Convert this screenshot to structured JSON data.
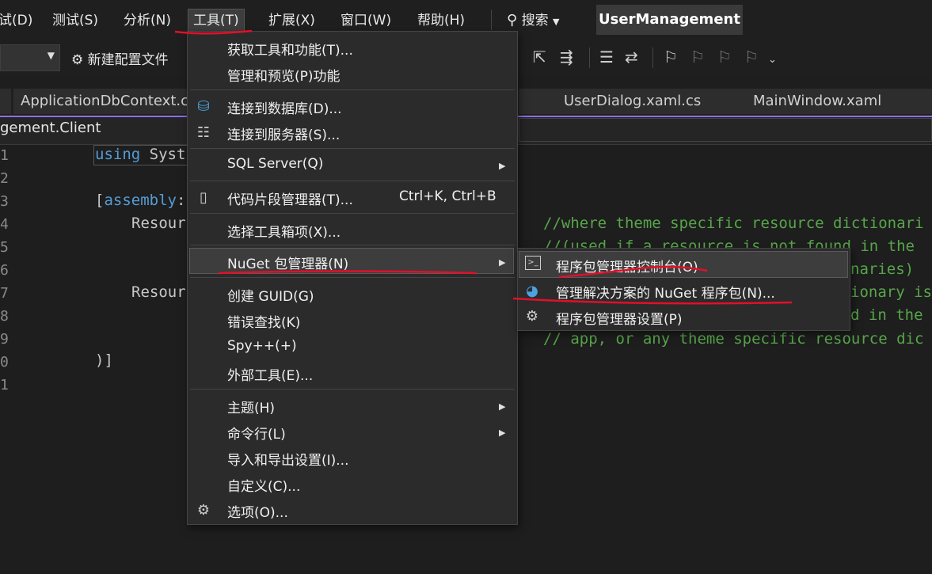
{
  "menubar": {
    "items": [
      "试(D)",
      "测试(S)",
      "分析(N)",
      "工具(T)",
      "扩展(X)",
      "窗口(W)",
      "帮助(H)"
    ],
    "search_label": "搜索",
    "solution_name": "UserManagement"
  },
  "toolbar": {
    "new_config_label": "新建配置文件"
  },
  "tabs": [
    "ApplicationDbContext.cs",
    "UserDialog.xaml.cs",
    "MainWindow.xaml"
  ],
  "navbar": {
    "project": "gement.Client"
  },
  "editor": {
    "line_numbers": [
      "1",
      "2",
      "3",
      "4",
      "5",
      "6",
      "7",
      "8",
      "9",
      "0",
      "1"
    ],
    "code": {
      "using_kw": "using",
      "using_rest": " Syst",
      "assembly_open": "[",
      "assembly_kw": "assembly",
      "assembly_colon": ":",
      "resour1": "Resour",
      "resour2": "Resour",
      "close": ")]"
    },
    "comments": [
      "//where theme specific resource dictionari",
      "//(used if a resource is not found in the",
      "naries)",
      "ionary is",
      "d in the",
      "// app, or any theme specific resource dic"
    ]
  },
  "tools_menu": {
    "items": [
      {
        "label": "获取工具和功能(T)..."
      },
      {
        "label": "管理和预览(P)功能"
      },
      {
        "label": "连接到数据库(D)...",
        "icon": "database-connect-icon"
      },
      {
        "label": "连接到服务器(S)...",
        "icon": "server-connect-icon"
      },
      {
        "label": "SQL Server(Q)",
        "submenu": true
      },
      {
        "label": "代码片段管理器(T)...",
        "shortcut": "Ctrl+K, Ctrl+B",
        "icon": "snippet-icon"
      },
      {
        "label": "选择工具箱项(X)..."
      },
      {
        "label": "NuGet 包管理器(N)",
        "submenu": true
      },
      {
        "label": "创建 GUID(G)"
      },
      {
        "label": "错误查找(K)"
      },
      {
        "label": "Spy++(+)"
      },
      {
        "label": "外部工具(E)..."
      },
      {
        "label": "主题(H)",
        "submenu": true
      },
      {
        "label": "命令行(L)",
        "submenu": true
      },
      {
        "label": "导入和导出设置(I)..."
      },
      {
        "label": "自定义(C)..."
      },
      {
        "label": "选项(O)...",
        "icon": "gear-icon"
      }
    ]
  },
  "nuget_submenu": {
    "items": [
      {
        "label": "程序包管理器控制台(O)",
        "icon": "console-icon"
      },
      {
        "label": "管理解决方案的 NuGet 程序包(N)...",
        "icon": "nuget-icon"
      },
      {
        "label": "程序包管理器设置(P)",
        "icon": "gear-icon"
      }
    ]
  },
  "colors": {
    "accent": "#8e6ee6",
    "annotation_red": "#e0102a",
    "comment_green": "#57a64a",
    "keyword_blue": "#569cd6"
  }
}
